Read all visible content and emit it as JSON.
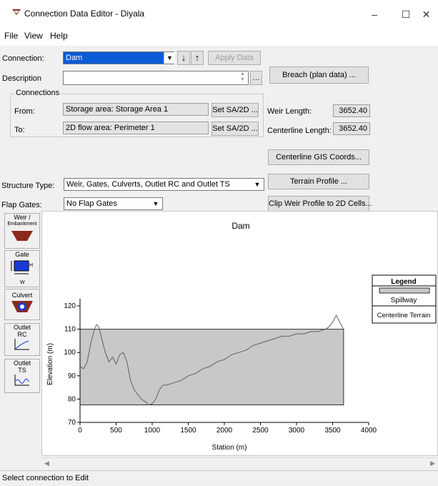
{
  "window": {
    "title": "Connection Data Editor - Diyala",
    "minimize": "–",
    "maximize": "☐",
    "close": "✕"
  },
  "menu": {
    "items": [
      "File",
      "View",
      "Help"
    ]
  },
  "form": {
    "connection_label": "Connection:",
    "connection_value": "Dam",
    "apply_label": "Apply Data",
    "description_label": "Description",
    "description_value": "",
    "breach_label": "Breach (plan data) ...",
    "connections_group": "Connections",
    "from_label": "From:",
    "from_value": "Storage area: Storage Area 1",
    "to_label": "To:",
    "to_value": "2D flow area: Perimeter 1",
    "set_sa_label": "Set SA/2D ...",
    "weir_length_label": "Weir Length:",
    "weir_length_value": "3652.40",
    "centerline_length_label": "Centerline Length:",
    "centerline_length_value": "3652.40",
    "centerline_gis_label": "Centerline GIS Coords...",
    "terrain_profile_label": "Terrain Profile ...",
    "structure_type_label": "Structure Type:",
    "structure_type_value": "Weir, Gates, Culverts, Outlet RC and Outlet TS",
    "flap_gates_label": "Flap Gates:",
    "flap_gates_value": "No Flap Gates",
    "clip_label": "Clip Weir Profile to 2D Cells..."
  },
  "sidebar": {
    "weir_line1": "Weir /",
    "weir_line2": "Embankment",
    "gate": "Gate",
    "gate_h": "H",
    "gate_w": "W",
    "culvert": "Culvert",
    "outlet_rc_line1": "Outlet",
    "outlet_rc_line2": "RC",
    "outlet_ts_line1": "Outlet",
    "outlet_ts_line2": "TS"
  },
  "status": {
    "text": "Select connection to Edit"
  },
  "colors": {
    "spillway_fill": "#c8c8c8",
    "terrain_line": "#606060",
    "weir_icon": "#8b2a1a",
    "gate_icon": "#1a3ad6"
  },
  "chart_data": {
    "type": "area",
    "title": "Dam",
    "xlabel": "Station (m)",
    "ylabel": "Elevation (m)",
    "xlim": [
      0,
      4000
    ],
    "ylim": [
      70,
      120
    ],
    "xticks": [
      0,
      500,
      1000,
      1500,
      2000,
      2500,
      3000,
      3500,
      4000
    ],
    "yticks": [
      70,
      80,
      90,
      100,
      110,
      120
    ],
    "legend": {
      "title": "Legend",
      "placement": "right",
      "entries": [
        "Spillway",
        "Centerline Terrain"
      ]
    },
    "spillway": {
      "name": "Spillway",
      "x": [
        0,
        0,
        3652.4,
        3652.4
      ],
      "y": [
        77.5,
        110,
        110,
        77.5
      ]
    },
    "terrain": {
      "name": "Centerline Terrain",
      "x": [
        0,
        50,
        100,
        150,
        200,
        230,
        260,
        300,
        350,
        400,
        450,
        500,
        550,
        600,
        650,
        700,
        750,
        800,
        850,
        900,
        950,
        1000,
        1050,
        1100,
        1150,
        1200,
        1300,
        1400,
        1500,
        1600,
        1700,
        1800,
        1900,
        2000,
        2100,
        2200,
        2300,
        2400,
        2500,
        2600,
        2700,
        2800,
        2900,
        3000,
        3100,
        3200,
        3300,
        3400,
        3450,
        3500,
        3550,
        3600,
        3650
      ],
      "y": [
        94,
        93,
        96,
        104,
        110,
        112,
        111,
        106,
        100,
        96,
        98,
        95,
        99,
        100,
        96,
        88,
        84,
        82,
        80,
        79,
        77.5,
        78,
        80,
        84,
        86,
        86,
        87,
        88,
        90,
        91,
        93,
        94,
        96,
        97,
        99,
        100,
        101,
        103,
        104,
        105,
        106,
        107,
        107,
        108,
        108,
        109,
        109,
        110,
        111,
        113,
        116,
        113,
        110
      ]
    }
  }
}
